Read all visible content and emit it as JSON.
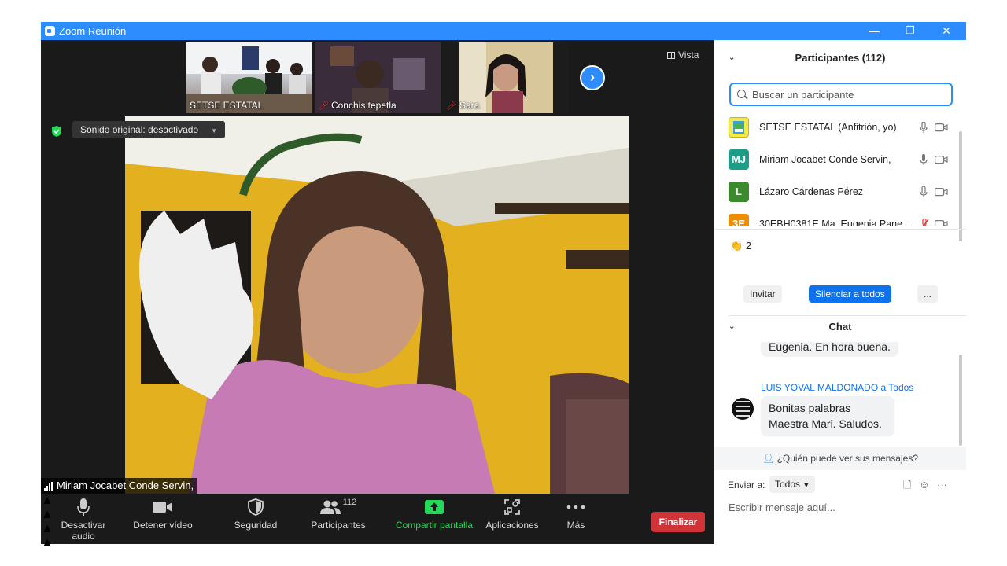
{
  "window": {
    "title": "Zoom Reunión",
    "minimize": "—",
    "restore": "❐",
    "close": "✕"
  },
  "gallery": {
    "thumbnails": [
      {
        "name": "SETSE ESTATAL",
        "muted": false
      },
      {
        "name": "Conchis  tepetla",
        "muted": true
      },
      {
        "name": "Sara",
        "muted": true
      }
    ],
    "next_arrow": "›",
    "view_label": "Vista"
  },
  "main_video": {
    "speaker_name": "Miriam Jocabet Conde Servin,",
    "sound_badge": "Sonido original: desactivado"
  },
  "toolbar": {
    "mute_label": "Desactivar audio",
    "video_label": "Detener vídeo",
    "security_label": "Seguridad",
    "participants_label": "Participantes",
    "participants_count": "112",
    "share_label": "Compartir pantalla",
    "apps_label": "Aplicaciones",
    "more_label": "Más",
    "end_label": "Finalizar",
    "colors": {
      "share": "#23d959",
      "end": "#d13438"
    }
  },
  "participants_panel": {
    "title": "Participantes (112)",
    "search_placeholder": "Buscar un participante",
    "participants": [
      {
        "name": "SETSE ESTATAL (Anfitrión, yo)",
        "initials": "",
        "avatar_color": "#f2e94e",
        "mic_muted": false
      },
      {
        "name": "Miriam Jocabet Conde Servin,",
        "initials": "MJ",
        "avatar_color": "#1a9e88",
        "mic_muted": false
      },
      {
        "name": "Lázaro Cárdenas Pérez",
        "initials": "L",
        "avatar_color": "#3b8a2e",
        "mic_muted": false
      },
      {
        "name": "30EBH0381E Ma. Eugenia Pane...",
        "initials": "3E",
        "avatar_color": "#f08c00",
        "mic_muted": true
      }
    ],
    "reaction_count": "2",
    "invite_label": "Invitar",
    "mute_all_label": "Silenciar a todos",
    "more_label": "..."
  },
  "chat": {
    "title": "Chat",
    "prev_message_tail": "Eugenia. En hora buena.",
    "sender": "LUIS YOVAL MALDONADO a Todos",
    "message_line1": "Bonitas palabras",
    "message_line2": "Maestra Mari. Saludos.",
    "who_can_see": "¿Quién puede ver sus mensajes?",
    "send_to_label": "Enviar a:",
    "send_to_value": "Todos",
    "input_placeholder": "Escribir mensaje aquí..."
  }
}
